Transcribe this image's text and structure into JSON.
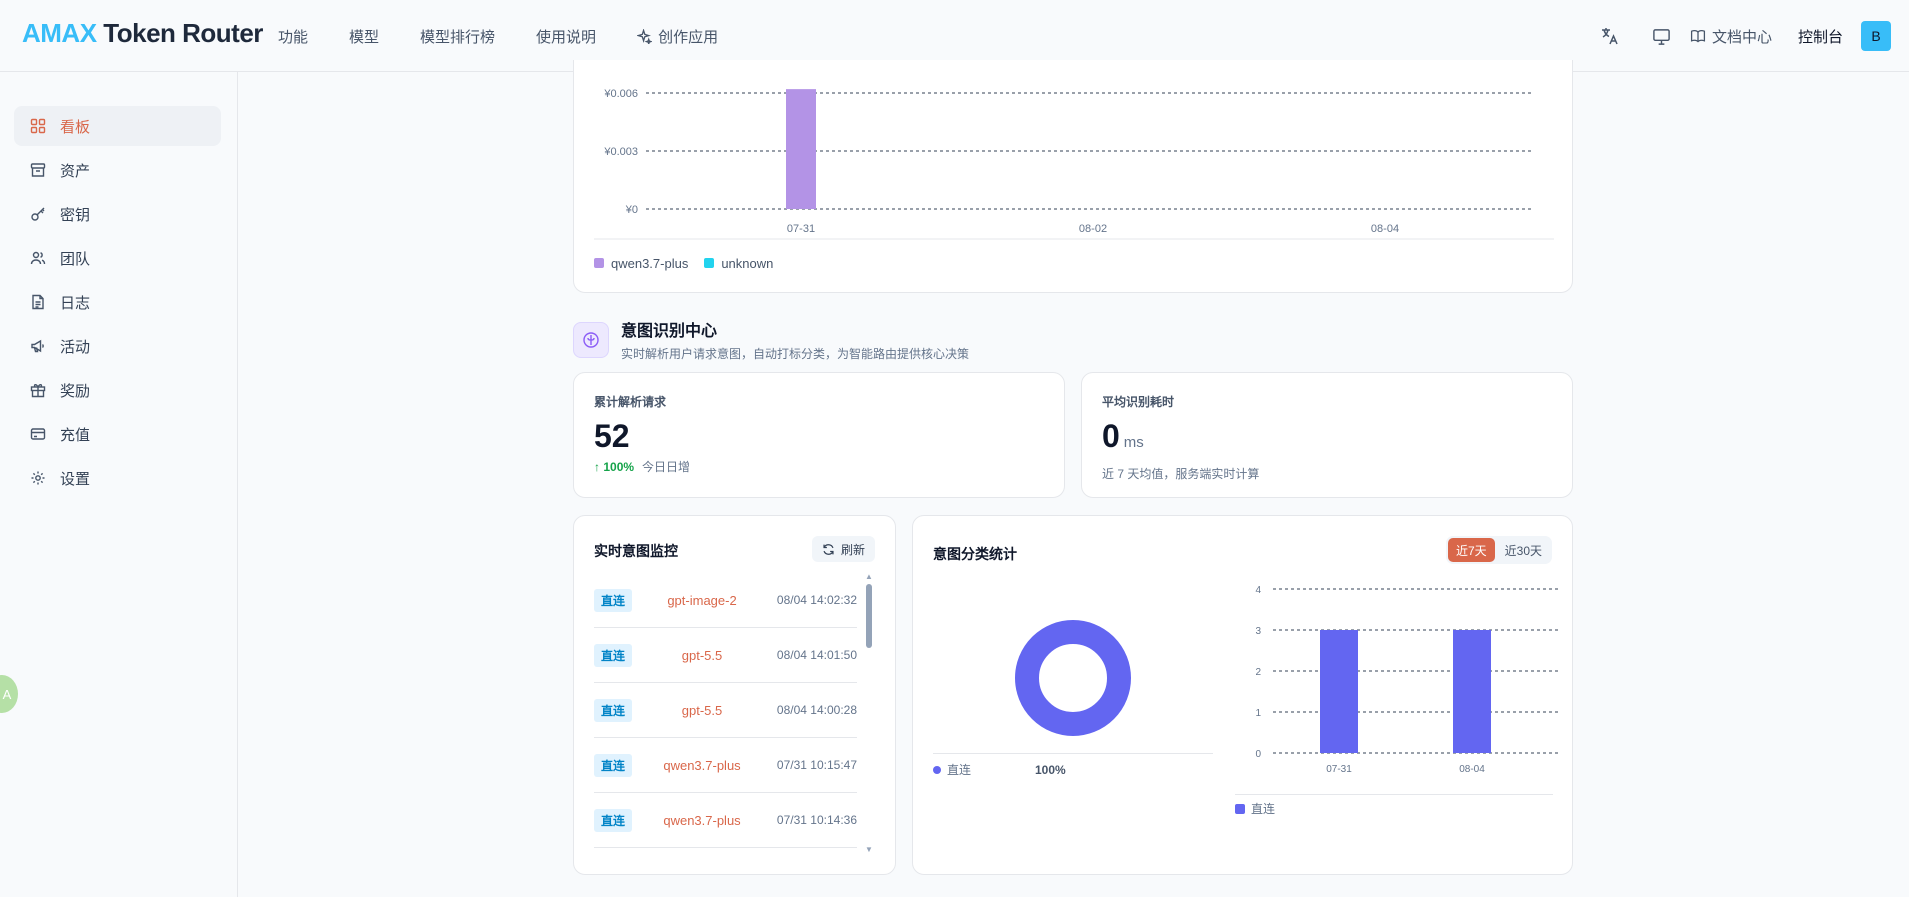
{
  "header": {
    "logo_accent": "AMAX",
    "logo_rest": " Token Router",
    "nav": [
      {
        "label": "功能"
      },
      {
        "label": "模型"
      },
      {
        "label": "模型排行榜"
      },
      {
        "label": "使用说明"
      },
      {
        "label": "创作应用",
        "icon": "sparkle-icon"
      }
    ],
    "docs_label": "文档中心",
    "console_label": "控制台",
    "avatar_letter": "B"
  },
  "sidebar": {
    "items": [
      {
        "label": "看板",
        "icon": "dashboard-icon",
        "active": true
      },
      {
        "label": "资产",
        "icon": "archive-icon"
      },
      {
        "label": "密钥",
        "icon": "key-icon"
      },
      {
        "label": "团队",
        "icon": "users-icon"
      },
      {
        "label": "日志",
        "icon": "file-text-icon"
      },
      {
        "label": "活动",
        "icon": "megaphone-icon"
      },
      {
        "label": "奖励",
        "icon": "gift-icon"
      },
      {
        "label": "充值",
        "icon": "credit-card-icon"
      },
      {
        "label": "设置",
        "icon": "gear-icon"
      }
    ],
    "float_badge": "A"
  },
  "cost_chart": {
    "chart_data": {
      "type": "bar",
      "categories": [
        "07-31",
        "08-02",
        "08-04"
      ],
      "y_ticks": [
        "¥0",
        "¥0.003",
        "¥0.006"
      ],
      "ylim": [
        0,
        0.006
      ],
      "series": [
        {
          "name": "qwen3.7-plus",
          "color": "#b393e6",
          "values": [
            0.0062,
            0,
            0
          ]
        },
        {
          "name": "unknown",
          "color": "#22d3ee",
          "values": [
            0,
            0,
            0
          ]
        }
      ],
      "grid": true,
      "legend": "bottom-left"
    }
  },
  "intent_section": {
    "title": "意图识别中心",
    "subtitle": "实时解析用户请求意图，自动打标分类，为智能路由提供核心决策"
  },
  "stats": {
    "total": {
      "label": "累计解析请求",
      "value": "52",
      "change": "100%",
      "change_label": "今日日增"
    },
    "latency": {
      "label": "平均识别耗时",
      "value": "0",
      "unit": "ms",
      "foot": "近 7 天均值，服务端实时计算"
    }
  },
  "monitor": {
    "title": "实时意图监控",
    "refresh_label": "刷新",
    "rows": [
      {
        "tag": "直连",
        "model": "gpt-image-2",
        "time": "08/04 14:02:32"
      },
      {
        "tag": "直连",
        "model": "gpt-5.5",
        "time": "08/04 14:01:50"
      },
      {
        "tag": "直连",
        "model": "gpt-5.5",
        "time": "08/04 14:00:28"
      },
      {
        "tag": "直连",
        "model": "qwen3.7-plus",
        "time": "07/31 10:15:47"
      },
      {
        "tag": "直连",
        "model": "qwen3.7-plus",
        "time": "07/31 10:14:36"
      }
    ]
  },
  "classification": {
    "title": "意图分类统计",
    "range_options": [
      "近7天",
      "近30天"
    ],
    "selected_range": "近7天",
    "donut": {
      "chart_data": {
        "type": "pie",
        "slices": [
          {
            "name": "直连",
            "value": 100,
            "color": "#6366f1"
          }
        ]
      },
      "legend_name": "直连",
      "legend_value": "100%"
    },
    "bars": {
      "chart_data": {
        "type": "bar",
        "categories": [
          "07-31",
          "08-04"
        ],
        "series": [
          {
            "name": "直连",
            "color": "#6366f1",
            "values": [
              3,
              3
            ]
          }
        ],
        "y_ticks": [
          "0",
          "1",
          "2",
          "3",
          "4"
        ],
        "ylim": [
          0,
          4
        ],
        "grid": true,
        "legend": "bottom-left"
      }
    }
  }
}
